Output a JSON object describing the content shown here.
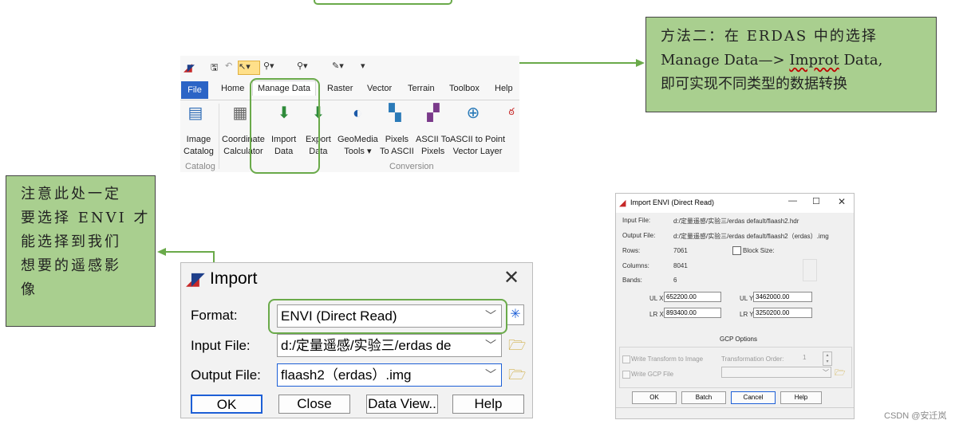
{
  "callout_top": {
    "line1": "方法二：在 ERDAS 中的选择",
    "line2_pre": "Manage Data—> ",
    "line2_squig": "Improt",
    "line2_post": " Data,",
    "line3": "即可实现不同类型的数据转换"
  },
  "callout_left": {
    "lines": [
      "注意此处一定",
      "要选择 ENVI 才",
      "能选择到我们",
      "想要的遥感影",
      "像"
    ]
  },
  "ribbon": {
    "tabs": [
      "File",
      "Home",
      "Manage Data",
      "Raster",
      "Vector",
      "Terrain",
      "Toolbox",
      "Help"
    ],
    "buttons": [
      {
        "line1": "Image",
        "line2": "Catalog"
      },
      {
        "line1": "Coordinate",
        "line2": "Calculator"
      },
      {
        "line1": "Import",
        "line2": "Data"
      },
      {
        "line1": "Export",
        "line2": "Data"
      },
      {
        "line1": "GeoMedia",
        "line2": "Tools ▾"
      },
      {
        "line1": "Pixels",
        "line2": "To ASCII"
      },
      {
        "line1": "ASCII To",
        "line2": "Pixels"
      },
      {
        "line1": "ASCII to Point",
        "line2": "Vector Layer"
      }
    ],
    "groups": [
      "Catalog",
      "Conversion"
    ]
  },
  "import_dialog": {
    "title": "Import",
    "format_label": "Format:",
    "format_value": "ENVI (Direct Read)",
    "input_label": "Input File:",
    "input_value": "d:/定量遥感/实验三/erdas de",
    "output_label": "Output File:",
    "output_value": "flaash2（erdas）.img",
    "ok": "OK",
    "close": "Close",
    "data_view": "Data View..",
    "help": "Help"
  },
  "envi_dialog": {
    "title": "Import ENVI (Direct Read)",
    "input_file_label": "Input File:",
    "input_file_value": "d:/定量遥感/实验三/erdas default/flaash2.hdr",
    "output_file_label": "Output File:",
    "output_file_value": "d:/定量遥感/实验三/erdas default/flaash2（erdas）.img",
    "rows_label": "Rows:",
    "rows_value": "7061",
    "block_size_label": "Block Size:",
    "columns_label": "Columns:",
    "columns_value": "8041",
    "bands_label": "Bands:",
    "bands_value": "6",
    "ulx_label": "UL X:",
    "ulx_value": "652200.00",
    "uly_label": "UL Y:",
    "uly_value": "3462000.00",
    "lrx_label": "LR X:",
    "lrx_value": "893400.00",
    "lry_label": "LR Y:",
    "lry_value": "3250200.00",
    "gcp_options": "GCP Options",
    "write_transform": "Write Transform to Image",
    "transformation_order_label": "Transformation Order:",
    "transformation_order_value": "1",
    "write_gcp": "Write GCP File",
    "ok": "OK",
    "batch": "Batch",
    "cancel": "Cancel",
    "help": "Help"
  },
  "watermark": "CSDN @安迁岚",
  "colors": {
    "callout_fill": "#a9cf8f",
    "highlight_green": "#6aaa4a",
    "file_tab": "#2b64c6"
  }
}
